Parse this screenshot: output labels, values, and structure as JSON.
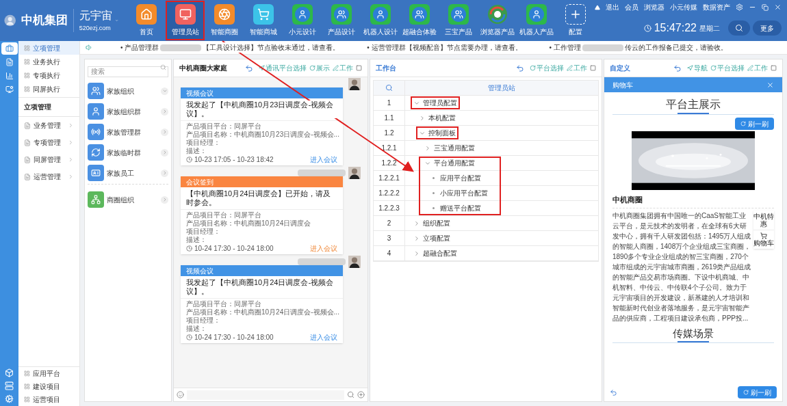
{
  "header": {
    "company": "中机集团",
    "brand": "元宇宙",
    "domain": "520ezj.com",
    "nav": [
      {
        "label": "首页",
        "highlighted": false
      },
      {
        "label": "管理员站",
        "highlighted": true
      },
      {
        "label": "智能商圈",
        "highlighted": false
      },
      {
        "label": "智能商城",
        "highlighted": false
      },
      {
        "label": "小元设计",
        "highlighted": false
      },
      {
        "label": "产品设计",
        "highlighted": false
      },
      {
        "label": "机器人设计",
        "highlighted": false
      },
      {
        "label": "超融合体验",
        "highlighted": false
      },
      {
        "label": "三宝产品",
        "highlighted": false
      },
      {
        "label": "浏览器产品",
        "highlighted": false
      },
      {
        "label": "机器人产品",
        "highlighted": false
      },
      {
        "label": "配置",
        "highlighted": false
      }
    ],
    "links": [
      "退出",
      "会员",
      "浏览器",
      "小元传媒",
      "数据资产"
    ],
    "time": "15:47:22",
    "weekday": "星期二",
    "more": "更多"
  },
  "notices": [
    {
      "before": "• 产品管理群",
      "after": "【工具设计选择】节点验收未通过，请查看。"
    },
    {
      "before": "• 运营管理群【视频配音】节点需要办理，请查看。"
    },
    {
      "before": "• 工作管理",
      "after": "传云的工作报备已提交，请验收。"
    }
  ],
  "sidebar": {
    "rail": [
      {
        "selected": true
      },
      {
        "selected": false
      },
      {
        "selected": false
      },
      {
        "selected": false
      }
    ],
    "top": [
      {
        "label": "立项管理",
        "selected": true
      },
      {
        "label": "业务执行",
        "selected": false
      },
      {
        "label": "专项执行",
        "selected": false
      },
      {
        "label": "同屏执行",
        "selected": false
      }
    ],
    "section": "立项管理",
    "groups": [
      "业务管理",
      "专项管理",
      "同屏管理",
      "运营管理"
    ],
    "bottom": [
      "应用平台",
      "建设项目",
      "运营项目"
    ]
  },
  "org": {
    "placeholder": "搜索",
    "items": [
      {
        "label": "家族组织",
        "color": "#4a90e2",
        "expanded": true
      },
      {
        "label": "家族组织群",
        "color": "#4a90e2",
        "expanded": false
      },
      {
        "label": "家族管理群",
        "color": "#4a90e2",
        "expanded": false
      },
      {
        "label": "家族临时群",
        "color": "#4a90e2",
        "expanded": false
      },
      {
        "label": "家族员工",
        "color": "#4a90e2",
        "expanded": false
      },
      {
        "label": "商圈组织",
        "color": "#5cb85c",
        "expanded": false
      }
    ]
  },
  "chat": {
    "title": "中机商圈大家庭",
    "actions": [
      "通讯平台选择",
      "展示",
      "工作"
    ],
    "messages": [
      {
        "kind": "video",
        "header": "视频会议",
        "body": "我发起了【中机商圈10月23日调度会-视频会议】。",
        "details": [
          "产品项目平台：同屏平台",
          "产品项目名称：中机商圈10月23日调度会-视频会...",
          "项目经理：",
          "描述："
        ],
        "time": "10-23 17:05 - 10-23 18:42",
        "link": "进入会议"
      },
      {
        "kind": "signin",
        "header": "会议签到",
        "body": "【中机商圈10月24日调度会】已开始，请及时参会。",
        "details": [
          "产品项目平台：同屏平台",
          "产品项目名称：中机商圈10月24日调度会",
          "项目经理：",
          "描述："
        ],
        "time": "10-24 17:30 - 10-24 18:00",
        "link": "进入会议"
      },
      {
        "kind": "video",
        "header": "视频会议",
        "body": "我发起了【中机商圈10月24日调度会-视频会议】。",
        "details": [
          "产品项目平台：同屏平台",
          "产品项目名称：中机商圈10月24日调度会-视频会...",
          "项目经理：",
          "描述："
        ],
        "time": "10-24 17:30 - 10-24 18:00",
        "link": "进入会议"
      }
    ]
  },
  "workbench": {
    "title": "工作台",
    "actions": [
      "平台选择",
      "工作"
    ],
    "column": "管理员站",
    "rows": [
      {
        "number": "1",
        "label": "管理员配置",
        "expanded": true,
        "highlighted": true,
        "children": [
          {
            "number": "1.1",
            "label": "本机配置",
            "expanded": false,
            "highlighted": false
          },
          {
            "number": "1.2",
            "label": "控制面板",
            "expanded": true,
            "highlighted": true,
            "children": [
              {
                "number": "1.2.1",
                "label": "三宝通用配置",
                "expanded": false,
                "highlighted": false
              },
              {
                "number": "1.2.2",
                "label": "平台通用配置",
                "expanded": true,
                "highlighted": true,
                "children": [
                  {
                    "number": "1.2.2.1",
                    "label": "应用平台配置",
                    "highlighted": true
                  },
                  {
                    "number": "1.2.2.2",
                    "label": "小应用平台配置",
                    "highlighted": true
                  },
                  {
                    "number": "1.2.2.3",
                    "label": "赠送平台配置",
                    "highlighted": true
                  }
                ]
              }
            ]
          }
        ]
      },
      {
        "number": "2",
        "label": "组织配置",
        "expanded": false,
        "highlighted": false
      },
      {
        "number": "3",
        "label": "立项配置",
        "expanded": false,
        "highlighted": false
      },
      {
        "number": "4",
        "label": "超融合配置",
        "expanded": false,
        "highlighted": false
      }
    ]
  },
  "custom": {
    "title": "自定义",
    "actions": [
      "导航",
      "平台选择",
      "工作"
    ],
    "drawer": "购物车",
    "section": "平台主展示",
    "refresh": "刷一刷",
    "company": "中机商圈",
    "lines": [
      "中机商圈集团拥有中国唯一的CaaS智能工业云平台，是元",
      "技术的发明者，在全球有6大研发中心，拥有千人研发团",
      "包括：1495万人组成的智能人商圈，1408万个企业组成",
      "三宝商圈，1890多个专业企业组成的智三宝商圈，270个城市组成的元宇宙城市商圈，2619类产品组成的智能产品交易市场商圈。下设中机商城、中机智料、中传云、中传联4个子公司。致力于元宇宙项目的开发建设，新基建的人才培训和智能新时代创业者落地服务，是元宇宙智能产品的供应商，工程项目建设承包商，PPP投..."
    ],
    "float": [
      "中机特惠",
      "购物车"
    ],
    "section2": "传媒场景",
    "refresh2": "刷一刷"
  }
}
